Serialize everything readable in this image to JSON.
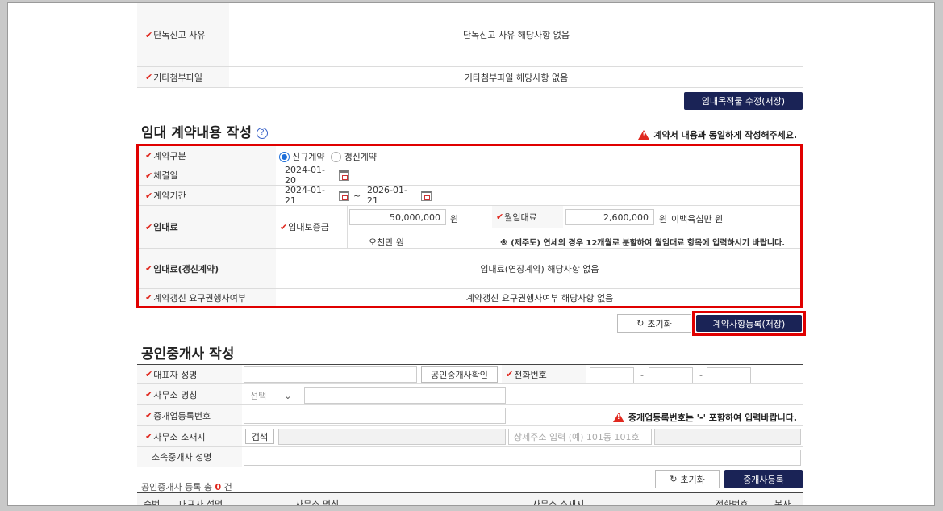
{
  "top": {
    "solo_report": {
      "label": "단독신고 사유",
      "value": "단독신고 사유 해당사항 없음"
    },
    "attachments": {
      "label": "기타첨부파일",
      "value": "기타첨부파일 해당사항 없음"
    },
    "save_button": "임대목적물 수정(저장)"
  },
  "contract": {
    "title": "임대 계약내용 작성",
    "help_icon": "?",
    "warning": "계약서 내용과 동일하게 작성해주세요.",
    "type": {
      "label": "계약구분",
      "options": [
        "신규계약",
        "갱신계약"
      ],
      "selected": "신규계약"
    },
    "sign_date": {
      "label": "체결일",
      "value": "2024-01-20"
    },
    "period": {
      "label": "계약기간",
      "start": "2024-01-21",
      "tilde": "~",
      "end": "2026-01-21"
    },
    "rent": {
      "label": "임대료",
      "deposit_label": "임대보증금",
      "deposit_value": "50,000,000",
      "deposit_unit": "원",
      "deposit_korean": "오천만 원",
      "monthly_label": "월임대료",
      "monthly_value": "2,600,000",
      "monthly_unit": "원",
      "monthly_korean": "이백육십만 원",
      "note": "※ (제주도) 연세의 경우 12개월로 분할하여 월임대료 항목에 입력하시기 바랍니다."
    },
    "rent_renewal": {
      "label": "임대료(갱신계약)",
      "value": "임대료(연장계약) 해당사항 없음"
    },
    "renewal_right": {
      "label": "계약갱신 요구권행사여부",
      "value": "계약갱신 요구권행사여부 해당사항 없음"
    },
    "reset_button": "초기화",
    "save_button": "계약사항등록(저장)"
  },
  "broker": {
    "title": "공인중개사 작성",
    "rep_name": {
      "label": "대표자 성명",
      "value": ""
    },
    "verify_button": "공인중개사확인",
    "phone": {
      "label": "전화번호",
      "sep": "-"
    },
    "office_name": {
      "label": "사무소 명칭",
      "select": "선택"
    },
    "reg_no": {
      "label": "중개업등록번호"
    },
    "reg_warning": "중개업등록번호는 '-' 포함하여 입력바랍니다.",
    "office_addr": {
      "label": "사무소 소재지",
      "search_button": "검색",
      "detail_placeholder": "상세주소 입력 (예) 101동 101호"
    },
    "affiliated": {
      "label": "소속중개사 성명"
    },
    "reset_button": "초기화",
    "register_button": "중개사등록",
    "count_prefix": "공인중개사 등록 총",
    "count": "0",
    "count_suffix": "건",
    "table_headers": [
      "순번",
      "대표자 성명",
      "사무소 명칭",
      "사무소 소재지",
      "전화번호",
      "복사"
    ]
  }
}
